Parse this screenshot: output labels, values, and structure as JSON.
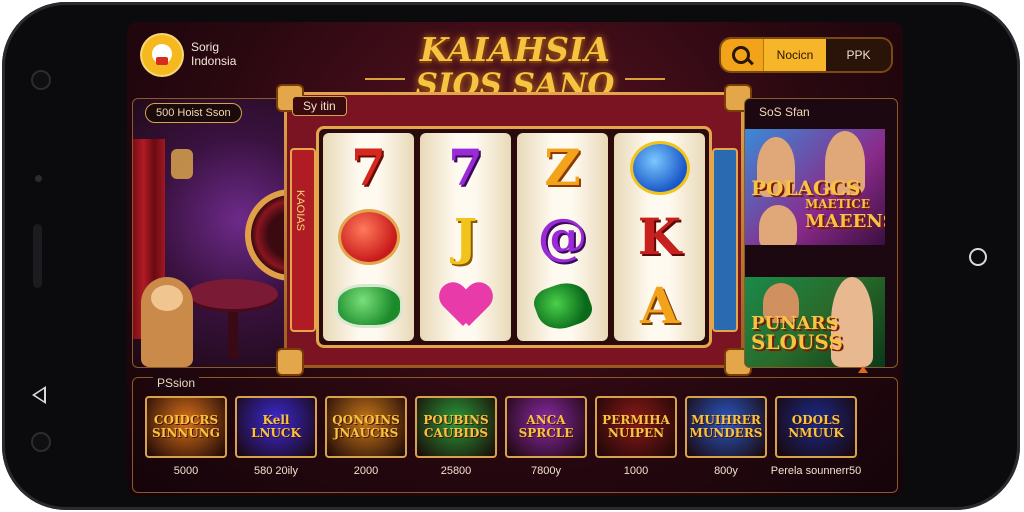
{
  "header": {
    "brand_line1": "Sorig",
    "brand_line2": "Indonsia",
    "title_line1": "KAIAHSIA",
    "title_line2": "SIOS SANO",
    "search_text": "Nocicn",
    "search_button": "PPK"
  },
  "left_panel": {
    "pill_label": "500 Hoist Sson"
  },
  "slot": {
    "tab_label": "Sy itin",
    "left_strip_text": "KAOIAS",
    "reels": [
      {
        "symbols": [
          {
            "glyph": "7",
            "kind": "text",
            "cls": "sym-7"
          },
          {
            "glyph": "",
            "kind": "gem-red"
          },
          {
            "glyph": "",
            "kind": "gem-green"
          }
        ]
      },
      {
        "symbols": [
          {
            "glyph": "7",
            "kind": "text",
            "cls": "sym-7p"
          },
          {
            "glyph": "J",
            "kind": "text",
            "cls": "sym-j"
          },
          {
            "glyph": "",
            "kind": "heart"
          }
        ]
      },
      {
        "symbols": [
          {
            "glyph": "Z",
            "kind": "text",
            "cls": "sym-z"
          },
          {
            "glyph": "@",
            "kind": "text",
            "cls": "sym-7p"
          },
          {
            "glyph": "",
            "kind": "clover"
          }
        ]
      },
      {
        "symbols": [
          {
            "glyph": "",
            "kind": "gem-blue"
          },
          {
            "glyph": "K",
            "kind": "text",
            "cls": "sym-k"
          },
          {
            "glyph": "A",
            "kind": "text",
            "cls": "sym-a"
          }
        ]
      }
    ]
  },
  "right_panel": {
    "title": "SoS Sfan",
    "promo1_line1": "POLAGCS",
    "promo1_line2": "MAETICE",
    "promo1_line3": "MAEENS",
    "promo2_line1": "PUNARS",
    "promo2_line2": "SLOUSS"
  },
  "games_section": {
    "label": "PSsion",
    "games": [
      {
        "title": "COIDCRS\nSINNUNG",
        "value": "5000",
        "bg": "#d8701a"
      },
      {
        "title": "Kell\nLNUCK",
        "value": "580 20ily",
        "bg": "#3a2ad8"
      },
      {
        "title": "QONOINS\nJNAUCRS",
        "value": "2000",
        "bg": "#c8781a"
      },
      {
        "title": "POUBINS\nCAUBIDS",
        "value": "25800",
        "bg": "#2a9a3a"
      },
      {
        "title": "ANCA\nSPRCLE",
        "value": "7800y",
        "bg": "#8a2aa8"
      },
      {
        "title": "PERMIHA\nNUIPEN",
        "value": "1000",
        "bg": "#8a1a18"
      },
      {
        "title": "MUIHRER\nMUNDERS",
        "value": "800y",
        "bg": "#2a58c8"
      },
      {
        "title": "ODOLS\nNMUUK",
        "value": "Perela sounnerr50",
        "bg": "#1a2a8a"
      }
    ]
  },
  "colors": {
    "accent": "#f2a31a",
    "frame_gold": "#e3a64a",
    "background": "#2a0810"
  }
}
